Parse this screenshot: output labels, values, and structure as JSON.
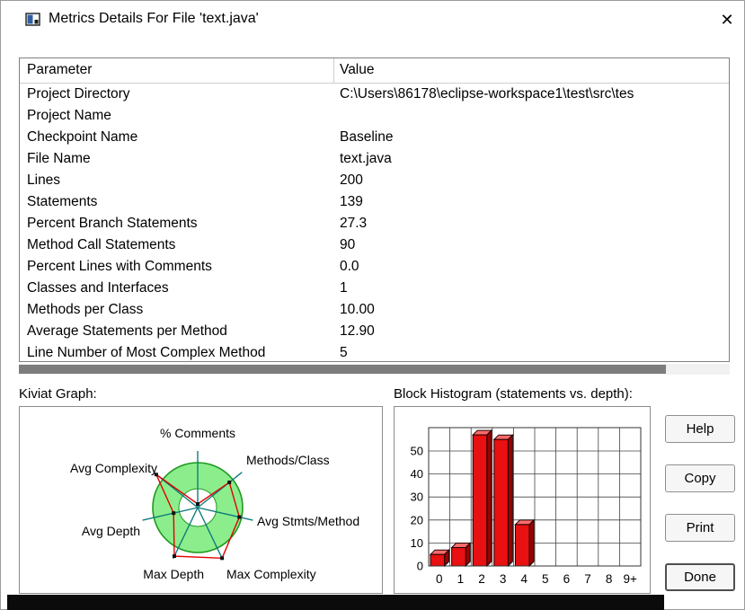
{
  "window": {
    "title": "Metrics Details For File 'text.java'",
    "close_glyph": "✕"
  },
  "metrics_table": {
    "columns": [
      "Parameter",
      "Value"
    ],
    "rows": [
      [
        "Project Directory",
        "C:\\Users\\86178\\eclipse-workspace1\\test\\src\\tes"
      ],
      [
        "Project Name",
        ""
      ],
      [
        "Checkpoint Name",
        "Baseline"
      ],
      [
        "File Name",
        "text.java"
      ],
      [
        "Lines",
        "200"
      ],
      [
        "Statements",
        "139"
      ],
      [
        "Percent Branch Statements",
        "27.3"
      ],
      [
        "Method Call Statements",
        "90"
      ],
      [
        "Percent Lines with Comments",
        "0.0"
      ],
      [
        "Classes and Interfaces",
        "1"
      ],
      [
        "Methods per Class",
        "10.00"
      ],
      [
        "Average Statements per Method",
        "12.90"
      ],
      [
        "Line Number of Most Complex Method",
        "5"
      ]
    ]
  },
  "kiviat": {
    "section_label": "Kiviat Graph:",
    "axes": [
      "% Comments",
      "Methods/Class",
      "Avg Stmts/Method",
      "Max Complexity",
      "Max Depth",
      "Avg Depth",
      "Avg Complexity"
    ],
    "values_norm": [
      0.08,
      0.9,
      0.95,
      1.25,
      1.2,
      0.55,
      1.18
    ],
    "ring_color": "#8ced8c",
    "spoke_color": "#0e7c7c",
    "data_color": "#e00000"
  },
  "histogram": {
    "section_label": "Block Histogram (statements vs. depth):",
    "x_labels": [
      "0",
      "1",
      "2",
      "3",
      "4",
      "5",
      "6",
      "7",
      "8",
      "9+"
    ],
    "y_ticks": [
      "0",
      "10",
      "20",
      "30",
      "40",
      "50"
    ],
    "values": [
      5,
      8,
      57,
      55,
      18,
      0,
      0,
      0,
      0,
      0
    ],
    "bar_color": "#e81010"
  },
  "buttons": [
    {
      "label": "Help"
    },
    {
      "label": "Copy"
    },
    {
      "label": "Print"
    },
    {
      "label": "Done"
    }
  ],
  "chart_data": [
    {
      "type": "radar",
      "title": "Kiviat Graph",
      "axes": [
        "% Comments",
        "Methods/Class",
        "Avg Stmts/Method",
        "Max Complexity",
        "Max Depth",
        "Avg Depth",
        "Avg Complexity"
      ],
      "values_normalized_to_ring_outer_edge": [
        0.08,
        0.9,
        0.95,
        1.25,
        1.2,
        0.55,
        1.18
      ],
      "legend_position": "none",
      "grid": false
    },
    {
      "type": "bar",
      "title": "Block Histogram (statements vs. depth)",
      "categories": [
        "0",
        "1",
        "2",
        "3",
        "4",
        "5",
        "6",
        "7",
        "8",
        "9+"
      ],
      "values": [
        5,
        8,
        57,
        55,
        18,
        0,
        0,
        0,
        0,
        0
      ],
      "xlabel": "depth",
      "ylabel": "statements",
      "ylim": [
        0,
        60
      ],
      "yticks": [
        0,
        10,
        20,
        30,
        40,
        50
      ],
      "grid": true
    }
  ]
}
